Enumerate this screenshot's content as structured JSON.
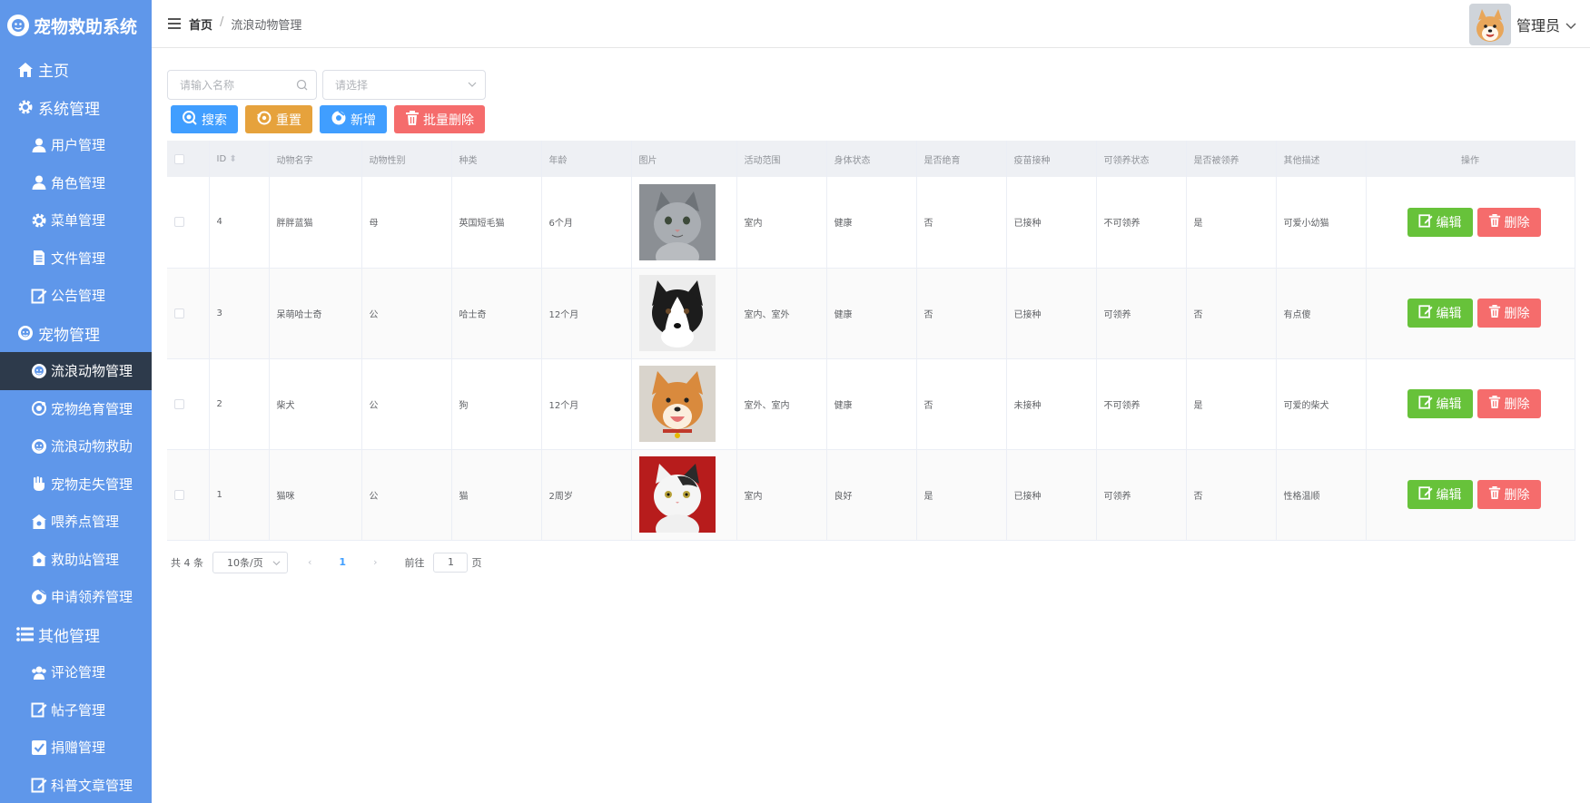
{
  "app": {
    "title": "宠物救助系统"
  },
  "sidebar": {
    "items": [
      {
        "label": "主页",
        "level": "top",
        "icon": "house-icon"
      },
      {
        "label": "系统管理",
        "level": "top",
        "icon": "gear-icon"
      },
      {
        "label": "用户管理",
        "level": "sub",
        "icon": "user-icon"
      },
      {
        "label": "角色管理",
        "level": "sub",
        "icon": "user-icon"
      },
      {
        "label": "菜单管理",
        "level": "sub",
        "icon": "gear-icon"
      },
      {
        "label": "文件管理",
        "level": "sub",
        "icon": "document-icon"
      },
      {
        "label": "公告管理",
        "level": "sub",
        "icon": "edit-icon"
      },
      {
        "label": "宠物管理",
        "level": "top",
        "icon": "pet-icon"
      },
      {
        "label": "流浪动物管理",
        "level": "sub",
        "icon": "pet-icon",
        "active": true
      },
      {
        "label": "宠物绝育管理",
        "level": "sub",
        "icon": "circle-icon"
      },
      {
        "label": "流浪动物救助",
        "level": "sub",
        "icon": "pet-icon"
      },
      {
        "label": "宠物走失管理",
        "level": "sub",
        "icon": "hand-icon"
      },
      {
        "label": "喂养点管理",
        "level": "sub",
        "icon": "shop-icon"
      },
      {
        "label": "救助站管理",
        "level": "sub",
        "icon": "shop-icon"
      },
      {
        "label": "申请领养管理",
        "level": "sub",
        "icon": "chrome-icon"
      },
      {
        "label": "其他管理",
        "level": "top",
        "icon": "list-icon"
      },
      {
        "label": "评论管理",
        "level": "sub",
        "icon": "users-icon"
      },
      {
        "label": "帖子管理",
        "level": "sub",
        "icon": "edit-icon"
      },
      {
        "label": "捐赠管理",
        "level": "sub",
        "icon": "check-icon"
      },
      {
        "label": "科普文章管理",
        "level": "sub",
        "icon": "edit-icon"
      }
    ]
  },
  "header": {
    "breadcrumb_home": "首页",
    "breadcrumb_sep": "/",
    "breadcrumb_current": "流浪动物管理",
    "user_name": "管理员"
  },
  "search": {
    "name_placeholder": "请输入名称",
    "select_placeholder": "请选择"
  },
  "toolbar": {
    "search_label": "搜索",
    "reset_label": "重置",
    "add_label": "新增",
    "batch_delete_label": "批量删除"
  },
  "table": {
    "columns": [
      "ID",
      "动物名字",
      "动物性别",
      "种类",
      "年龄",
      "图片",
      "活动范围",
      "身体状态",
      "是否绝育",
      "疫苗接种",
      "可领养状态",
      "是否被领养",
      "其他描述",
      "操作"
    ],
    "rows": [
      {
        "id": "4",
        "name": "胖胖蓝猫",
        "gender": "母",
        "kind": "英国短毛猫",
        "age": "6个月",
        "image": "gray-cat",
        "range": "室内",
        "health": "健康",
        "sterilized": "否",
        "vaccine": "已接种",
        "adoptable": "不可领养",
        "adopted": "是",
        "desc": "可爱小幼猫"
      },
      {
        "id": "3",
        "name": "呆萌哈士奇",
        "gender": "公",
        "kind": "哈士奇",
        "age": "12个月",
        "image": "husky",
        "range": "室内、室外",
        "health": "健康",
        "sterilized": "否",
        "vaccine": "已接种",
        "adoptable": "可领养",
        "adopted": "否",
        "desc": "有点傻"
      },
      {
        "id": "2",
        "name": "柴犬",
        "gender": "公",
        "kind": "狗",
        "age": "12个月",
        "image": "shiba",
        "range": "室外、室内",
        "health": "健康",
        "sterilized": "否",
        "vaccine": "未接种",
        "adoptable": "不可领养",
        "adopted": "是",
        "desc": "可爱的柴犬"
      },
      {
        "id": "1",
        "name": "猫咪",
        "gender": "公",
        "kind": "猫",
        "age": "2周岁",
        "image": "white-cat",
        "range": "室内",
        "health": "良好",
        "sterilized": "是",
        "vaccine": "已接种",
        "adoptable": "可领养",
        "adopted": "否",
        "desc": "性格温顺"
      }
    ],
    "edit_label": "编辑",
    "delete_label": "删除"
  },
  "pager": {
    "total_text": "共 4 条",
    "page_size": "10条/页",
    "current_page": "1",
    "goto_label": "前往",
    "goto_value": "1",
    "page_suffix": "页"
  },
  "colors": {
    "sidebar": "#5f97ea",
    "active": "#2d3a4b",
    "primary": "#409eff",
    "warning": "#e6a23c",
    "danger": "#f56c6c",
    "success": "#67c23a"
  }
}
